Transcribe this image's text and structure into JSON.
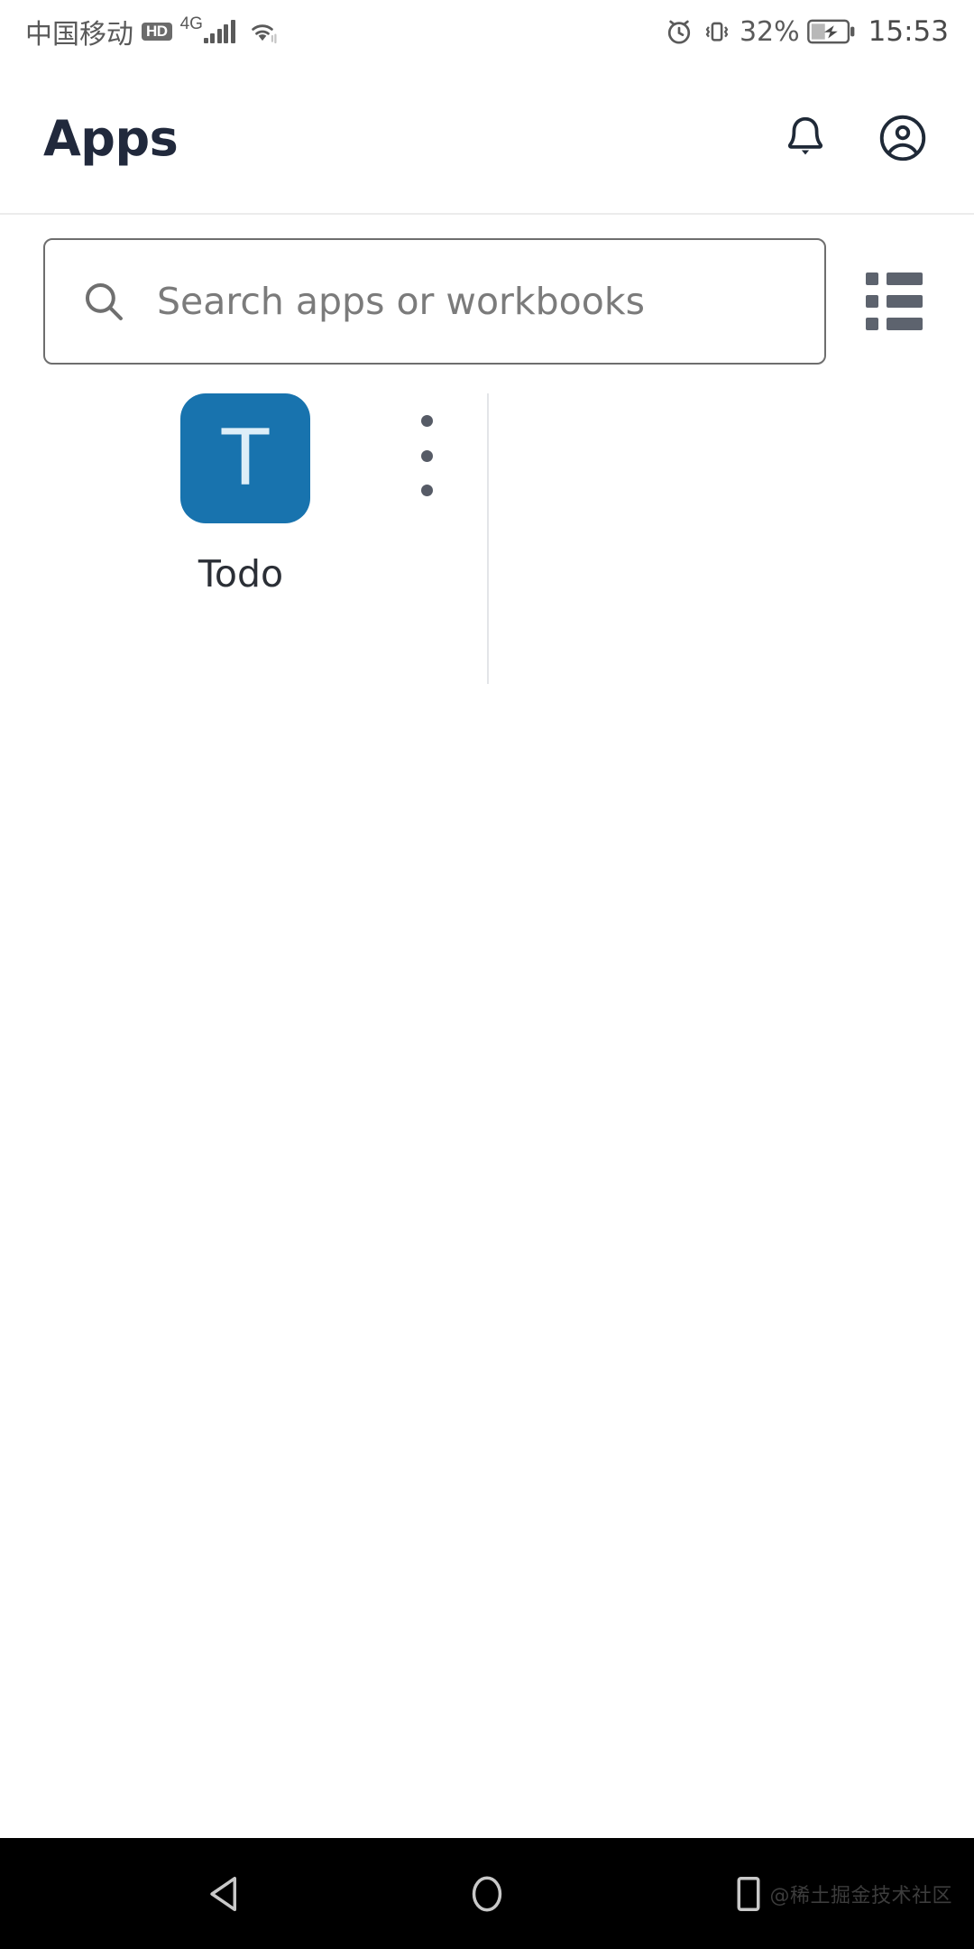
{
  "status_bar": {
    "carrier": "中国移动",
    "hd_badge": "HD",
    "network_type": "4G",
    "signal_icon": "signal-bars-icon",
    "wifi_icon": "wifi-icon",
    "alarm_icon": "alarm-clock-icon",
    "vibrate_icon": "vibrate-icon",
    "battery_percent": "32%",
    "battery_icon": "battery-charging-icon",
    "time": "15:53"
  },
  "header": {
    "title": "Apps",
    "notification_icon": "bell-icon",
    "account_icon": "account-circle-icon"
  },
  "search": {
    "placeholder": "Search apps or workbooks",
    "value": "",
    "search_icon": "search-icon",
    "view_toggle_icon": "list-view-icon"
  },
  "apps": [
    {
      "name": "Todo",
      "initial": "T",
      "icon_color": "#1873ae",
      "letter_color": "#ddeef8",
      "menu_icon": "more-vertical-icon"
    }
  ],
  "nav_bar": {
    "back_icon": "back-triangle-icon",
    "home_icon": "home-circle-icon",
    "recents_icon": "recents-square-icon",
    "watermark": "@稀土掘金技术社区"
  }
}
